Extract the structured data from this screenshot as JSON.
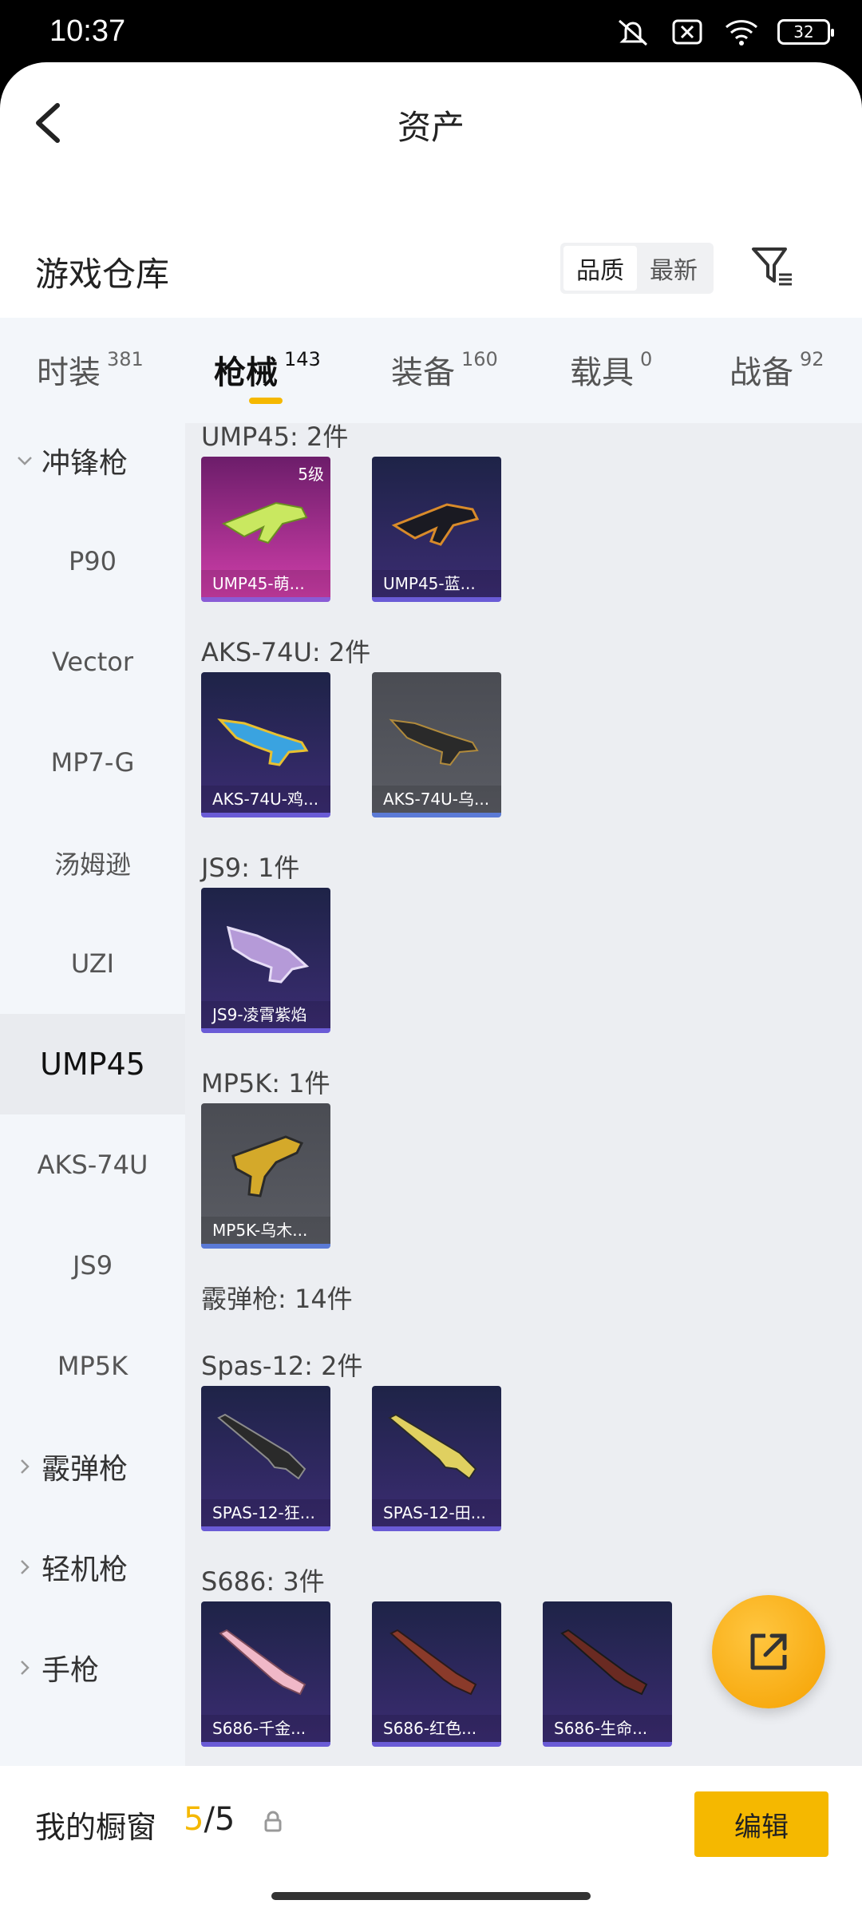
{
  "status": {
    "time": "10:37",
    "battery": "32"
  },
  "header": {
    "title": "资产"
  },
  "warehouse": {
    "title": "游戏仓库",
    "sort_options": [
      "品质",
      "最新"
    ]
  },
  "tabs": [
    {
      "label": "时装",
      "count": "381"
    },
    {
      "label": "枪械",
      "count": "143"
    },
    {
      "label": "装备",
      "count": "160"
    },
    {
      "label": "载具",
      "count": "0"
    },
    {
      "label": "战备",
      "count": "92"
    }
  ],
  "sidebar": {
    "items": [
      {
        "label": "冲锋枪",
        "type": "category"
      },
      {
        "label": "P90"
      },
      {
        "label": "Vector"
      },
      {
        "label": "MP7-G"
      },
      {
        "label": "汤姆逊"
      },
      {
        "label": "UZI"
      },
      {
        "label": "UMP45",
        "active": true
      },
      {
        "label": "AKS-74U"
      },
      {
        "label": "JS9"
      },
      {
        "label": "MP5K"
      },
      {
        "label": "霰弹枪",
        "type": "category"
      },
      {
        "label": "轻机枪",
        "type": "category"
      },
      {
        "label": "手枪",
        "type": "category"
      }
    ]
  },
  "groups": [
    {
      "title": "UMP45: 2件",
      "items": [
        {
          "name": "UMP45-萌...",
          "level": "5级",
          "rarity": "pink"
        },
        {
          "name": "UMP45-蓝...",
          "rarity": "purple"
        }
      ]
    },
    {
      "title": "AKS-74U: 2件",
      "items": [
        {
          "name": "AKS-74U-鸡...",
          "rarity": "purple"
        },
        {
          "name": "AKS-74U-乌...",
          "rarity": "gray"
        }
      ]
    },
    {
      "title": "JS9: 1件",
      "items": [
        {
          "name": "JS9-凌霄紫焰",
          "rarity": "purple"
        }
      ]
    },
    {
      "title": "MP5K: 1件",
      "items": [
        {
          "name": "MP5K-乌木...",
          "rarity": "gray"
        }
      ]
    },
    {
      "title": "霰弹枪: 14件",
      "items": []
    },
    {
      "title": "Spas-12: 2件",
      "items": [
        {
          "name": "SPAS-12-狂...",
          "rarity": "purple"
        },
        {
          "name": "SPAS-12-田...",
          "rarity": "purple"
        }
      ]
    },
    {
      "title": "S686: 3件",
      "items": [
        {
          "name": "S686-千金...",
          "rarity": "purple"
        },
        {
          "name": "S686-红色...",
          "rarity": "purple"
        },
        {
          "name": "S686-生命...",
          "rarity": "purple"
        }
      ]
    }
  ],
  "showcase": {
    "label": "我的橱窗",
    "current": "5",
    "total": "/5",
    "edit_label": "编辑"
  },
  "colors": {
    "accent": "#f5b800",
    "epic_purple": "#6a5bd6",
    "legend_pink": "#cf3ea9"
  },
  "icons": {
    "back": "chevron-left-icon",
    "filter": "filter-icon",
    "share": "share-external-icon",
    "lock": "lock-icon"
  }
}
